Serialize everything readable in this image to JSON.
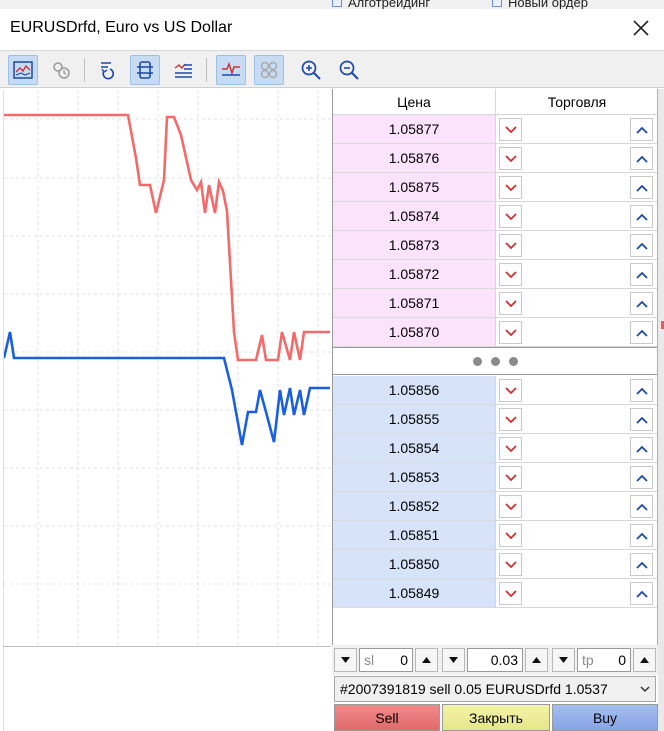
{
  "behind_window": {
    "tab1": "Алготрейдинг",
    "tab2": "Новый ордер"
  },
  "window": {
    "title": "EURUSDrfd, Euro vs US Dollar"
  },
  "toolbar": {
    "buttons": [
      {
        "icon": "chart-icon",
        "active": true
      },
      {
        "icon": "clock-history-icon",
        "active": false
      },
      {
        "icon": "reset-arrow-icon",
        "active": false
      },
      {
        "icon": "columns-icon",
        "active": true
      },
      {
        "icon": "list-lines-icon",
        "active": false
      },
      {
        "icon": "tick-chart-icon",
        "active": true
      },
      {
        "icon": "circles-icon",
        "active": true
      },
      {
        "icon": "zoom-in-icon",
        "active": false
      },
      {
        "icon": "zoom-out-icon",
        "active": false
      }
    ]
  },
  "colors": {
    "ask_line": "#f26a6a",
    "bid_line": "#1a5fe0",
    "ask_row": "#fbe3fb",
    "bid_row": "#d6e3f8",
    "sell_arrow": "#d03030",
    "buy_arrow": "#1b4aa8"
  },
  "depth": {
    "header_price": "Цена",
    "header_trade": "Торговля",
    "ask_prices": [
      "1.05877",
      "1.05876",
      "1.05875",
      "1.05874",
      "1.05873",
      "1.05872",
      "1.05871",
      "1.05870"
    ],
    "bid_prices": [
      "1.05856",
      "1.05855",
      "1.05854",
      "1.05853",
      "1.05852",
      "1.05851",
      "1.05850",
      "1.05849"
    ]
  },
  "controls": {
    "sl_placeholder": "sl",
    "sl_value": "0",
    "volume_value": "0.03",
    "tp_placeholder": "tp",
    "tp_value": "0"
  },
  "order_select": {
    "selected": "#2007391819 sell 0.05 EURUSDrfd 1.0537"
  },
  "actions": {
    "sell": "Sell",
    "close": "Закрыть",
    "buy": "Buy"
  }
}
